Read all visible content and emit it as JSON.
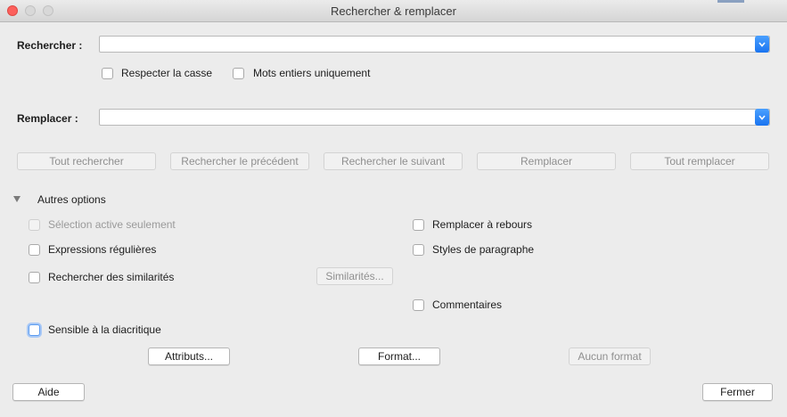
{
  "window": {
    "title": "Rechercher & remplacer"
  },
  "search": {
    "label": "Rechercher :",
    "value": ""
  },
  "options_top": {
    "match_case": "Respecter la casse",
    "whole_words": "Mots entiers uniquement"
  },
  "replace": {
    "label": "Remplacer :",
    "value": ""
  },
  "actions": {
    "find_all": "Tout rechercher",
    "find_prev": "Rechercher le précédent",
    "find_next": "Rechercher le suivant",
    "replace": "Remplacer",
    "replace_all": "Tout remplacer"
  },
  "more_options": {
    "header": "Autres options",
    "current_selection": "Sélection active seulement",
    "regex": "Expressions régulières",
    "similarity": "Rechercher des similarités",
    "similarities_button": "Similarités...",
    "diacritic": "Sensible à la diacritique",
    "backwards": "Remplacer à rebours",
    "para_styles": "Styles de paragraphe",
    "comments": "Commentaires",
    "attributes_button": "Attributs...",
    "format_button": "Format...",
    "no_format_button": "Aucun format"
  },
  "footer": {
    "help": "Aide",
    "close": "Fermer"
  },
  "colors": {
    "accent": "#1a74f0",
    "close_dot": "#fc605c"
  }
}
